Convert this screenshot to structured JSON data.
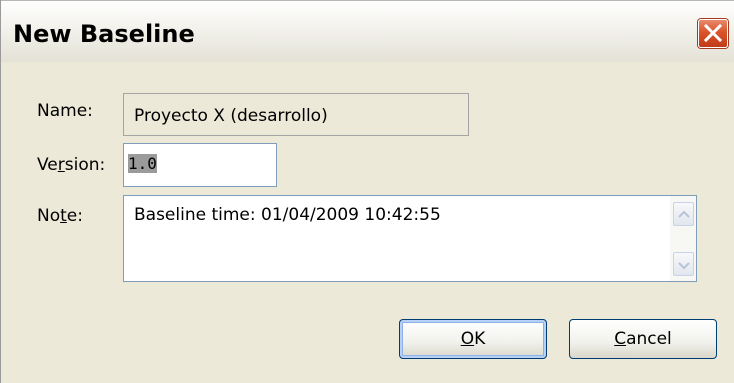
{
  "dialog": {
    "title": "New Baseline",
    "close_icon": "close-icon"
  },
  "form": {
    "name_label": "Name:",
    "name_value": "Proyecto X (desarrollo)",
    "version_label_pre": "Ve",
    "version_label_u": "r",
    "version_label_post": "sion:",
    "version_value": "1.0",
    "note_label_pre": "No",
    "note_label_u": "t",
    "note_label_post": "e:",
    "note_value": "Baseline time: 01/04/2009 10:42:55"
  },
  "buttons": {
    "ok_u": "O",
    "ok_rest": "K",
    "cancel_u": "C",
    "cancel_rest": "ancel"
  },
  "colors": {
    "dialog_bg": "#ece9d8",
    "close_button": "#d9542d",
    "default_button_focus": "#8cb0e8"
  }
}
